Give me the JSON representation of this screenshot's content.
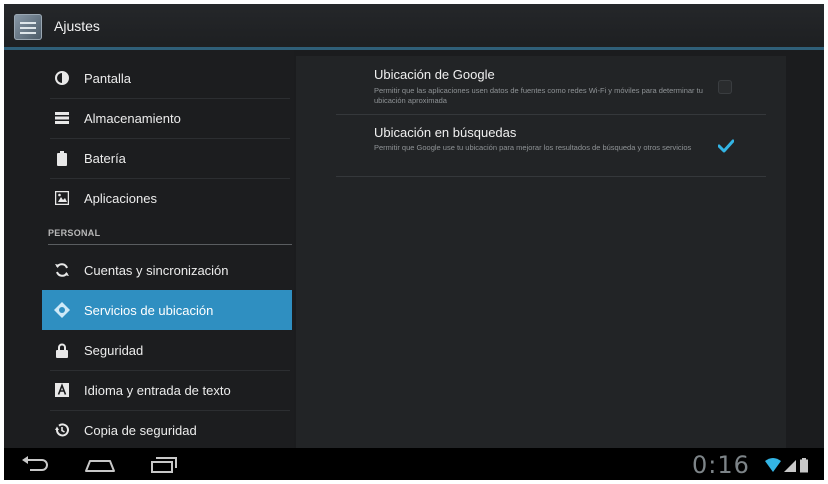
{
  "app": {
    "title": "Ajustes",
    "icon": "settings-app-icon"
  },
  "sidebar": {
    "items": [
      {
        "label": "Pantalla",
        "icon": "display-icon"
      },
      {
        "label": "Almacenamiento",
        "icon": "storage-icon"
      },
      {
        "label": "Batería",
        "icon": "battery-icon"
      },
      {
        "label": "Aplicaciones",
        "icon": "apps-icon"
      }
    ],
    "section_header": "PERSONAL",
    "personal_items": [
      {
        "label": "Cuentas y sincronización",
        "icon": "sync-icon"
      },
      {
        "label": "Servicios de ubicación",
        "icon": "location-icon",
        "selected": true
      },
      {
        "label": "Seguridad",
        "icon": "lock-icon"
      },
      {
        "label": "Idioma y entrada de texto",
        "icon": "language-icon"
      },
      {
        "label": "Copia de seguridad",
        "icon": "backup-icon"
      }
    ]
  },
  "location": {
    "prefs": [
      {
        "title": "Ubicación de Google",
        "summary": "Permitir que las aplicaciones usen datos de fuentes como redes Wi-Fi y móviles para determinar tu ubicación aproximada",
        "checked": false
      },
      {
        "title": "Ubicación en búsquedas",
        "summary": "Permitir que Google use tu ubicación para mejorar los resultados de búsqueda y otros servicios",
        "checked": true
      }
    ]
  },
  "status": {
    "clock": "0:16",
    "icons": [
      "wifi-icon",
      "signal-icon",
      "battery-status-icon"
    ]
  },
  "colors": {
    "accent": "#33b5e5",
    "selected_bg": "#2f8fc1",
    "background": "#1b1c1e"
  }
}
